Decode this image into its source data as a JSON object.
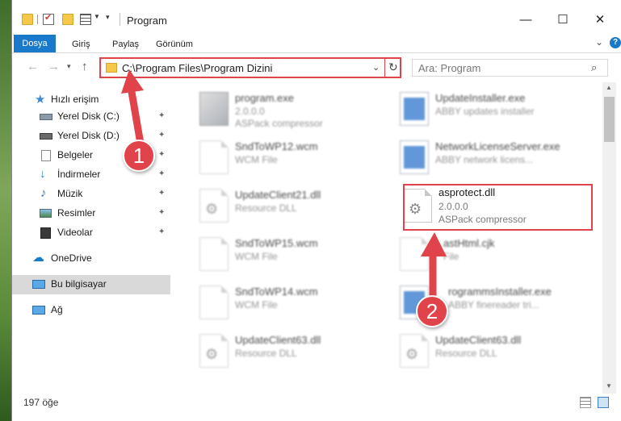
{
  "window": {
    "title": "Program",
    "controls": {
      "minimize": "—",
      "maximize": "☐",
      "close": "✕"
    }
  },
  "ribbon": {
    "tabs": [
      {
        "label": "Dosya",
        "active": true
      },
      {
        "label": "Giriş"
      },
      {
        "label": "Paylaş"
      },
      {
        "label": "Görünüm"
      }
    ],
    "expand_icon": "chevron-down-icon",
    "help_icon": "help-icon"
  },
  "nav": {
    "back": "←",
    "forward": "→",
    "recent": "▾",
    "up": "↑",
    "address": "C:\\Program Files\\Program Dizini",
    "address_dropdown": "⌄",
    "refresh": "↻"
  },
  "search": {
    "placeholder": "Ara: Program",
    "icon": "search-icon"
  },
  "sidebar": {
    "items": [
      {
        "label": "Hızlı erişim",
        "icon": "star-icon",
        "pinned": false
      },
      {
        "label": "Yerel Disk (C:)",
        "icon": "drive-icon",
        "pinned": true
      },
      {
        "label": "Yerel Disk (D:)",
        "icon": "drive-icon",
        "pinned": true
      },
      {
        "label": "Belgeler",
        "icon": "documents-icon",
        "pinned": true
      },
      {
        "label": "İndirmeler",
        "icon": "download-icon",
        "pinned": true
      },
      {
        "label": "Müzik",
        "icon": "music-icon",
        "pinned": true
      },
      {
        "label": "Resimler",
        "icon": "pictures-icon",
        "pinned": true
      },
      {
        "label": "Videolar",
        "icon": "video-icon",
        "pinned": true
      },
      {
        "label": "OneDrive",
        "icon": "cloud-icon",
        "pinned": false
      },
      {
        "label": "Bu bilgisayar",
        "icon": "computer-icon",
        "pinned": false,
        "selected": true
      },
      {
        "label": "Ağ",
        "icon": "network-icon",
        "pinned": false
      }
    ],
    "pin_glyph": "📌"
  },
  "files": {
    "left": [
      {
        "name": "program.exe",
        "line2": "2.0.0.0",
        "line3": "ASPack compressor",
        "icon": "exe-icon"
      },
      {
        "name": "SndToWP12.wcm",
        "line2": "WCM File",
        "icon": "document-icon"
      },
      {
        "name": "UpdateClient21.dll",
        "line2": "Resource DLL",
        "icon": "dll-gears-icon"
      },
      {
        "name": "SndToWP15.wcm",
        "line2": "WCM File",
        "icon": "document-icon"
      },
      {
        "name": "SndToWP14.wcm",
        "line2": "WCM File",
        "icon": "document-icon"
      },
      {
        "name": "UpdateClient63.dll",
        "line2": "Resource DLL",
        "icon": "dll-gears-icon"
      }
    ],
    "right": [
      {
        "name": "UpdateInstaller.exe",
        "line2": "ABBY updates installer",
        "icon": "app-icon"
      },
      {
        "name": "NetworkLicenseServer.exe",
        "line2": "ABBY network licens...",
        "icon": "app-icon"
      },
      {
        "name": "asprotect.dll",
        "line2": "2.0.0.0",
        "line3": "ASPack compressor",
        "icon": "dll-gears-icon",
        "highlighted": true
      },
      {
        "name": "astHtml.cjk",
        "line2": "File",
        "icon": "document-icon"
      },
      {
        "name": "rogrammsInstaller.exe",
        "line2": "ABBY finereader tri...",
        "icon": "app-icon"
      },
      {
        "name": "UpdateClient63.dll",
        "line2": "Resource DLL",
        "icon": "dll-gears-icon"
      }
    ]
  },
  "status": {
    "count": "197 öğe"
  },
  "callouts": [
    "1",
    "2"
  ],
  "colors": {
    "accent": "#1979ca",
    "highlight": "#e0434a"
  }
}
